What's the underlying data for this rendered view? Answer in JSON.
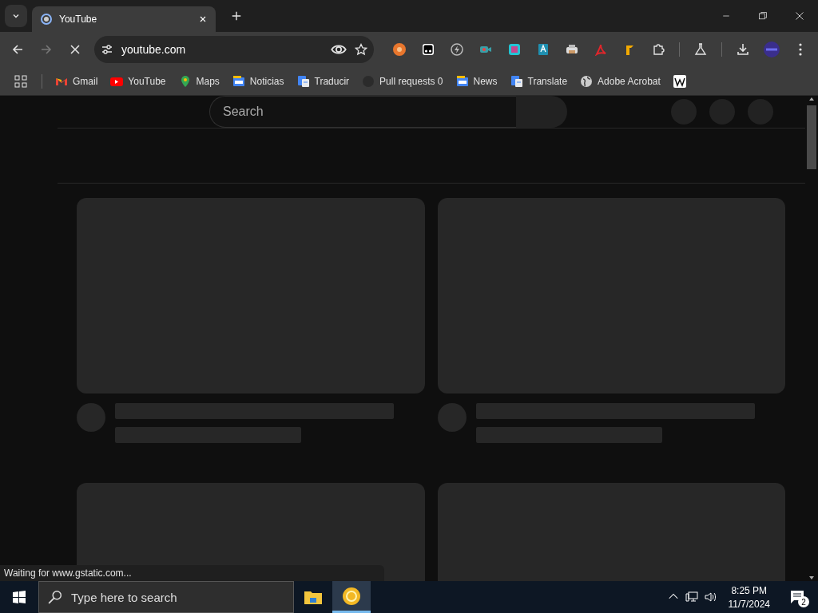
{
  "tabs": [
    {
      "title": "YouTube",
      "selected": true
    }
  ],
  "toolbar": {
    "address": "youtube.com",
    "loading": true
  },
  "extensions": [
    {
      "kind": "orange"
    },
    {
      "kind": "mask"
    },
    {
      "kind": "bolt"
    },
    {
      "kind": "camera"
    },
    {
      "kind": "square"
    },
    {
      "kind": "letter"
    },
    {
      "kind": "printer"
    },
    {
      "kind": "acrobat"
    },
    {
      "kind": "flag"
    }
  ],
  "bookmarks": [
    {
      "label": "Gmail",
      "kind": "gmail"
    },
    {
      "label": "YouTube",
      "kind": "youtube"
    },
    {
      "label": "Maps",
      "kind": "maps"
    },
    {
      "label": "Noticias",
      "kind": "news"
    },
    {
      "label": "Traducir",
      "kind": "translate"
    },
    {
      "label": "Pull requests 0",
      "kind": "github"
    },
    {
      "label": "News",
      "kind": "news"
    },
    {
      "label": "Translate",
      "kind": "translate"
    },
    {
      "label": "Adobe Acrobat",
      "kind": "globe"
    },
    {
      "kind": "wiki"
    }
  ],
  "page": {
    "search": {
      "placeholder": "Search"
    },
    "cards": [
      {
        "kind": "skeleton"
      },
      {
        "kind": "skeleton"
      },
      {
        "kind": "thumbnail"
      },
      {
        "kind": "thumbnail"
      }
    ]
  },
  "status_bar": "Waiting for www.gstatic.com...",
  "taskbar": {
    "search": {
      "placeholder": "Type here to search"
    },
    "apps": [
      {
        "kind": "explorer",
        "selected": false
      },
      {
        "kind": "chrome",
        "selected": true
      }
    ],
    "time": "8:25 PM",
    "date": "11/7/2024",
    "notifications": "2"
  }
}
